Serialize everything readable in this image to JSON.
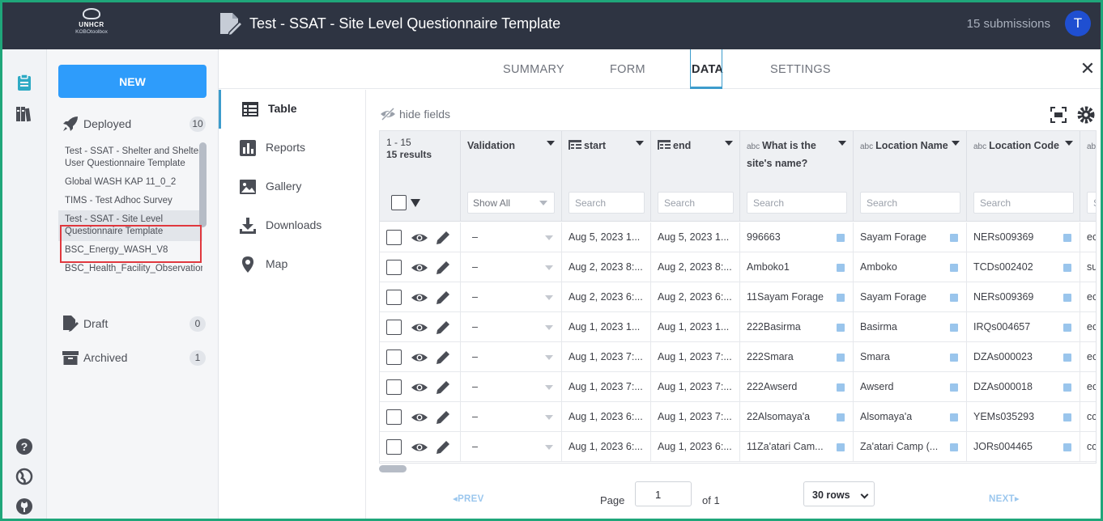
{
  "header": {
    "logo_org": "UNHCR",
    "logo_tool": "KOBOtoolbox",
    "project_title": "Test - SSAT - Site Level Questionnaire Template",
    "submissions": "15 submissions",
    "avatar_letter": "T",
    "avatar_color": "#1f4fd1"
  },
  "sidebar": {
    "new_label": "NEW",
    "deployed": {
      "label": "Deployed",
      "count": "10"
    },
    "projects": [
      "Test - SSAT - Shelter and Shelter User Questionnaire Template",
      "Global WASH KAP 11_0_2",
      "TIMS - Test Adhoc Survey",
      "Test - SSAT - Site Level Questionnaire Template",
      "BSC_Energy_WASH_V8",
      "BSC_Health_Facility_Observation_v16"
    ],
    "draft": {
      "label": "Draft",
      "count": "0"
    },
    "archived": {
      "label": "Archived",
      "count": "1"
    }
  },
  "tabs": {
    "summary": "SUMMARY",
    "form": "FORM",
    "data": "DATA",
    "settings": "SETTINGS"
  },
  "subnav": {
    "table": "Table",
    "reports": "Reports",
    "gallery": "Gallery",
    "downloads": "Downloads",
    "map": "Map"
  },
  "toolbar": {
    "hide_fields": "hide fields"
  },
  "table": {
    "range": "1 - 15",
    "results": "15 results",
    "columns": {
      "validation": "Validation",
      "start": "start",
      "end": "end",
      "site_name": "What is the site's name?",
      "location_name": "Location Name",
      "location_code": "Location Code",
      "type_abbr": "abc"
    },
    "validation_filter": "Show All",
    "search_placeholder": "Search",
    "rows": [
      {
        "validation": "–",
        "start": "Aug 5, 2023 1...",
        "end": "Aug 5, 2023 1...",
        "site": "996663",
        "loc_name": "Sayam Forage",
        "loc_code": "NERs009369",
        "extra": "ec"
      },
      {
        "validation": "–",
        "start": "Aug 2, 2023 8:...",
        "end": "Aug 2, 2023 8:...",
        "site": "Amboko1",
        "loc_name": "Amboko",
        "loc_code": "TCDs002402",
        "extra": "su"
      },
      {
        "validation": "–",
        "start": "Aug 2, 2023 6:...",
        "end": "Aug 2, 2023 6:...",
        "site": "11Sayam Forage",
        "loc_name": "Sayam Forage",
        "loc_code": "NERs009369",
        "extra": "ec"
      },
      {
        "validation": "–",
        "start": "Aug 1, 2023 1...",
        "end": "Aug 1, 2023 1...",
        "site": "222Basirma",
        "loc_name": "Basirma",
        "loc_code": "IRQs004657",
        "extra": "ec"
      },
      {
        "validation": "–",
        "start": "Aug 1, 2023 7:...",
        "end": "Aug 1, 2023 7:...",
        "site": "222Smara",
        "loc_name": "Smara",
        "loc_code": "DZAs000023",
        "extra": "ec"
      },
      {
        "validation": "–",
        "start": "Aug 1, 2023 7:...",
        "end": "Aug 1, 2023 7:...",
        "site": "222Awserd",
        "loc_name": "Awserd",
        "loc_code": "DZAs000018",
        "extra": "ec"
      },
      {
        "validation": "–",
        "start": "Aug 1, 2023 6:...",
        "end": "Aug 1, 2023 7:...",
        "site": "22Alsomaya'a",
        "loc_name": "Alsomaya'a",
        "loc_code": "YEMs035293",
        "extra": "cc"
      },
      {
        "validation": "–",
        "start": "Aug 1, 2023 6:...",
        "end": "Aug 1, 2023 6:...",
        "site": "11Za'atari Cam...",
        "loc_name": "Za'atari Camp (...",
        "loc_code": "JORs004465",
        "extra": "cc"
      }
    ]
  },
  "pager": {
    "prev": "PREV",
    "page_label": "Page",
    "page_value": "1",
    "of_label": "of 1",
    "rows_select": "30 rows",
    "next": "NEXT"
  },
  "colors": {
    "accent": "#3d9ccc",
    "new_button": "#2e9cfb",
    "topbar": "#2e3442",
    "frame": "#1fa67a",
    "highlight": "#e0383e"
  }
}
